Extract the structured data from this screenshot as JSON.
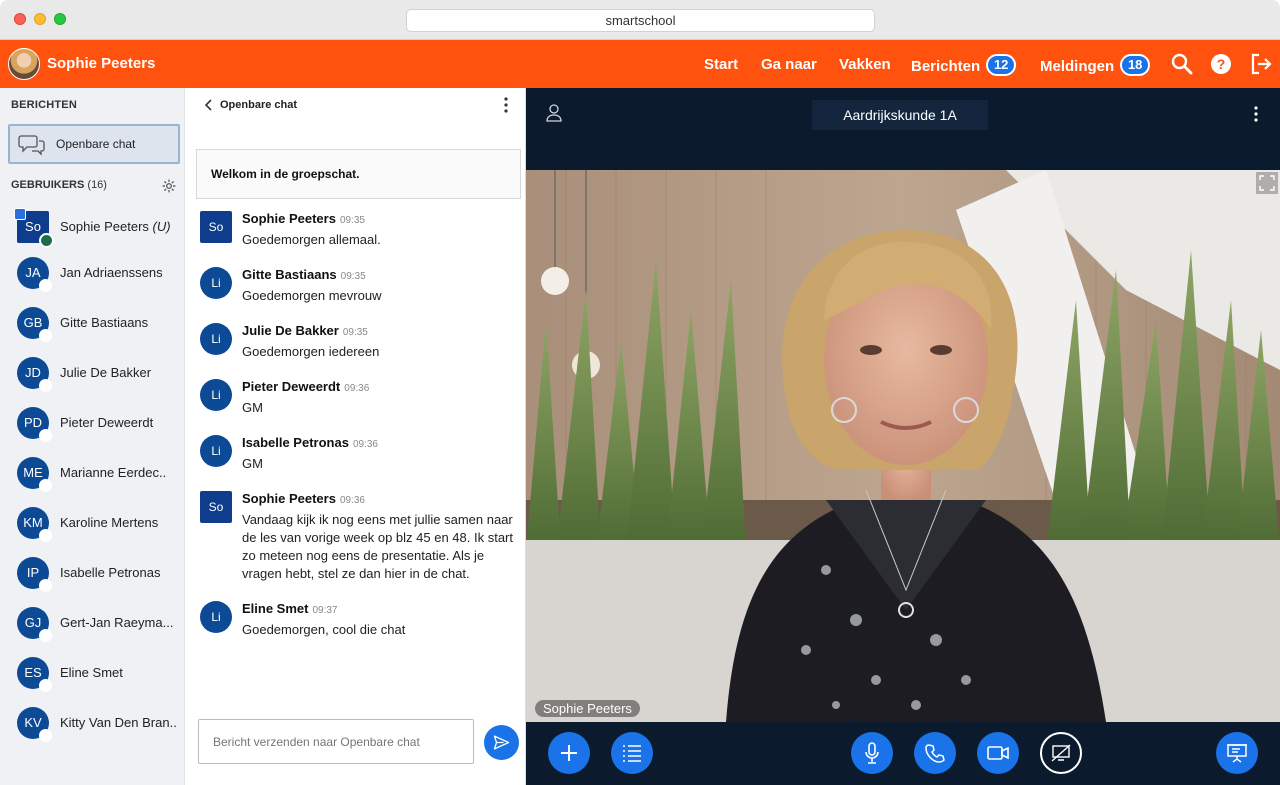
{
  "window": {
    "url": "smartschool"
  },
  "topnav": {
    "user_name": "Sophie Peeters",
    "items": [
      {
        "label": "Start"
      },
      {
        "label": "Ga naar"
      },
      {
        "label": "Vakken"
      },
      {
        "label": "Berichten",
        "badge": "12"
      },
      {
        "label": "Meldingen",
        "badge": "18"
      }
    ],
    "icons": [
      "search-icon",
      "help-icon",
      "logout-icon"
    ],
    "accent": "#ff520e"
  },
  "sidebar": {
    "section_title": "BERICHTEN",
    "openbare_label": "Openbare chat",
    "users_title": "GEBRUIKERS",
    "users_count": "(16)",
    "users": [
      {
        "initials": "So",
        "name": "Sophie Peeters",
        "suffix": "(U)"
      },
      {
        "initials": "JA",
        "name": "Jan Adriaenssens"
      },
      {
        "initials": "GB",
        "name": "Gitte Bastiaans"
      },
      {
        "initials": "JD",
        "name": "Julie De Bakker"
      },
      {
        "initials": "PD",
        "name": "Pieter Deweerdt"
      },
      {
        "initials": "ME",
        "name": "Marianne Eerdec.."
      },
      {
        "initials": "KM",
        "name": "Karoline Mertens"
      },
      {
        "initials": "IP",
        "name": "Isabelle Petronas"
      },
      {
        "initials": "GJ",
        "name": "Gert-Jan Raeyma..."
      },
      {
        "initials": "ES",
        "name": "Eline Smet"
      },
      {
        "initials": "KV",
        "name": "Kitty Van Den Bran.."
      }
    ]
  },
  "chat": {
    "title": "Openbare chat",
    "welcome": "Welkom in de groepschat.",
    "messages": [
      {
        "initials": "So",
        "author": "Sophie Peeters",
        "time": "09:35",
        "text": "Goedemorgen allemaal."
      },
      {
        "initials": "Li",
        "author": "Gitte Bastiaans",
        "time": "09:35",
        "text": "Goedemorgen mevrouw"
      },
      {
        "initials": "Li",
        "author": "Julie De Bakker",
        "time": "09:35",
        "text": "Goedemorgen iedereen"
      },
      {
        "initials": "Li",
        "author": "Pieter Deweerdt",
        "time": "09:36",
        "text": "GM"
      },
      {
        "initials": "Li",
        "author": "Isabelle Petronas",
        "time": "09:36",
        "text": "GM"
      },
      {
        "initials": "So",
        "author": "Sophie Peeters",
        "time": "09:36",
        "text": "Vandaag kijk ik nog eens met jullie samen naar de les van vorige week op blz 45 en 48. Ik start zo meteen nog eens de presentatie. Als je vragen hebt, stel ze dan hier in de chat."
      },
      {
        "initials": "Li",
        "author": "Eline Smet",
        "time": "09:37",
        "text": "Goedemorgen, cool die chat"
      }
    ],
    "composer_placeholder": "Bericht verzenden naar Openbare chat"
  },
  "video": {
    "room_name": "Aardrijkskunde 1A",
    "presenter_name": "Sophie Peeters",
    "controls_left": [
      "plus-icon",
      "list-icon"
    ],
    "controls_center": [
      "microphone-icon",
      "phone-icon",
      "camera-icon",
      "screenshare-off-icon"
    ],
    "controls_right": [
      "presentation-icon"
    ]
  }
}
